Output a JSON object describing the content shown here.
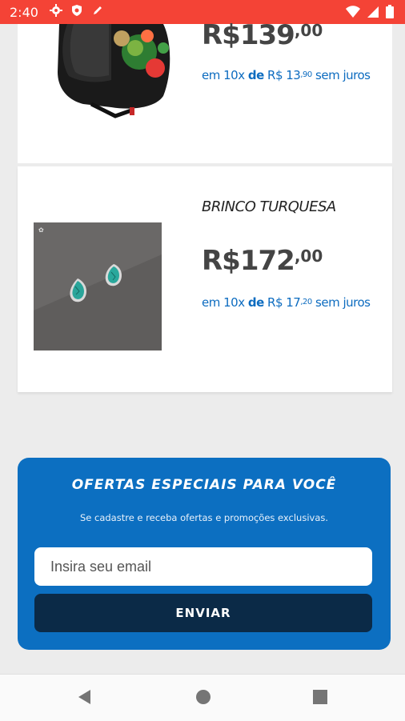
{
  "status_bar": {
    "time": "2:40",
    "left_icons": [
      "settings-icon",
      "shield-icon",
      "pen-icon"
    ],
    "right_icons": [
      "wifi-icon",
      "signal-icon",
      "battery-icon"
    ],
    "color": "#f44336"
  },
  "products": [
    {
      "name": "",
      "price_main": "R$139",
      "price_cents": ",00",
      "installment_prefix": "em 10x ",
      "installment_de": "de",
      "installment_value": " R$ 13",
      "installment_cents": ",90",
      "installment_suffix": " sem juros"
    },
    {
      "name": "BRINCO TURQUESA",
      "price_main": "R$172",
      "price_cents": ",00",
      "installment_prefix": "em 10x ",
      "installment_de": "de",
      "installment_value": " R$ 17",
      "installment_cents": ",20",
      "installment_suffix": " sem juros"
    }
  ],
  "newsletter": {
    "title": "OFERTAS ESPECIAIS PARA VOCÊ",
    "subtitle": "Se cadastre e receba ofertas e promoções exclusivas.",
    "email_placeholder": "Insira seu email",
    "button_label": "ENVIAR",
    "background_color": "#0c6fc1",
    "button_color": "#0b2a47"
  },
  "nav_bar": {
    "buttons": [
      "back-icon",
      "home-icon",
      "recents-icon"
    ]
  }
}
